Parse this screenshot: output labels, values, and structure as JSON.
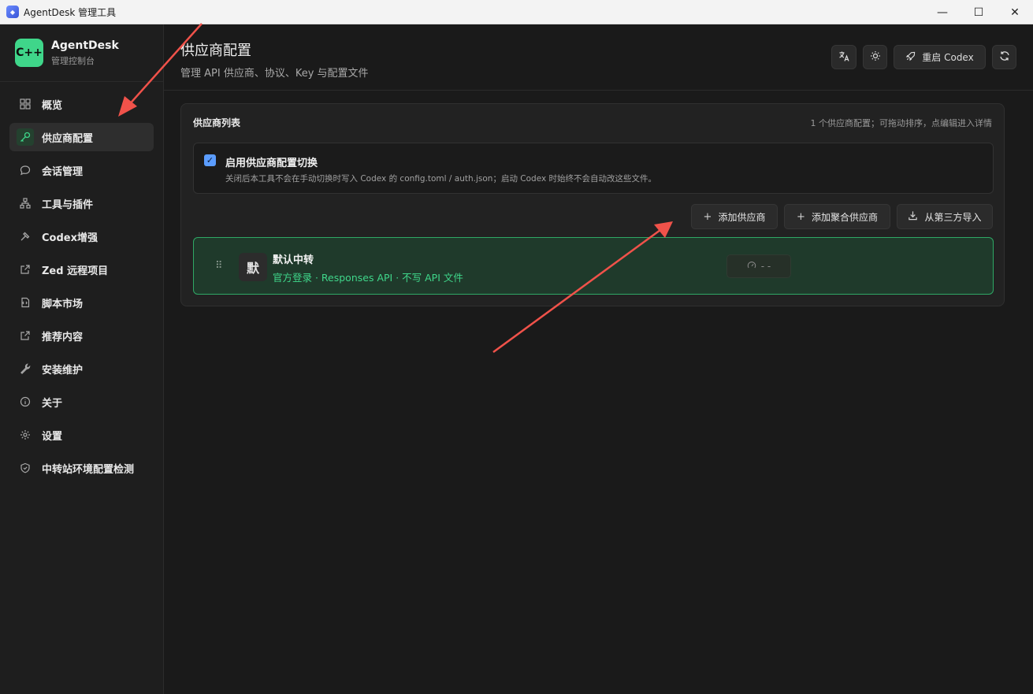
{
  "window": {
    "title": "AgentDesk 管理工具",
    "controls": [
      "minimize-icon",
      "maximize-icon",
      "close-icon"
    ]
  },
  "brand": {
    "logo_text": "C++",
    "name": "AgentDesk",
    "subtitle": "管理控制台",
    "accent": "#3fd68a"
  },
  "sidebar": {
    "items": [
      {
        "label": "概览",
        "icon": "grid-icon",
        "active": false
      },
      {
        "label": "供应商配置",
        "icon": "key-icon",
        "active": true
      },
      {
        "label": "会话管理",
        "icon": "chat-icon",
        "active": false
      },
      {
        "label": "工具与插件",
        "icon": "network-icon",
        "active": false
      },
      {
        "label": "Codex增强",
        "icon": "hammer-icon",
        "active": false
      },
      {
        "label": "Zed 远程项目",
        "icon": "external-link-icon",
        "active": false
      },
      {
        "label": "脚本市场",
        "icon": "script-icon",
        "active": false
      },
      {
        "label": "推荐内容",
        "icon": "external-link-icon",
        "active": false
      },
      {
        "label": "安装维护",
        "icon": "wrench-icon",
        "active": false
      },
      {
        "label": "关于",
        "icon": "info-icon",
        "active": false
      },
      {
        "label": "设置",
        "icon": "gear-icon",
        "active": false
      },
      {
        "label": "中转站环境配置检测",
        "icon": "shield-icon",
        "active": false
      }
    ]
  },
  "header": {
    "title": "供应商配置",
    "subtitle": "管理 API 供应商、协议、Key 与配置文件",
    "restart_label": "重启 Codex"
  },
  "card": {
    "title": "供应商列表",
    "hint": "1 个供应商配置；可拖动排序，点编辑进入详情",
    "toggle": {
      "checked": true,
      "title": "启用供应商配置切换",
      "description": "关闭后本工具不会在手动切换时写入 Codex 的 config.toml / auth.json；启动 Codex 时始终不会自动改这些文件。"
    },
    "actions": {
      "add": "添加供应商",
      "add_aggregate": "添加聚合供应商",
      "import": "从第三方导入"
    },
    "providers": [
      {
        "avatar": "默",
        "name": "默认中转",
        "meta": "官方登录 · Responses API · 不写 API 文件",
        "speed": "- -"
      }
    ]
  }
}
